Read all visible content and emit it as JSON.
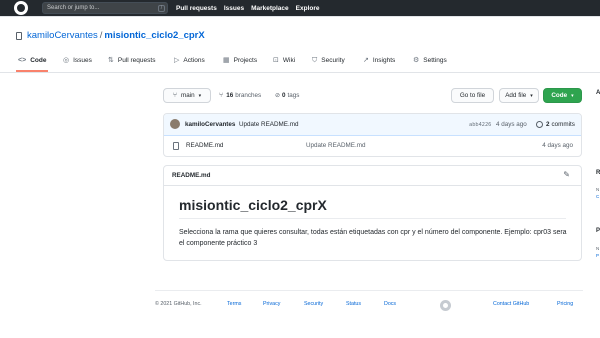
{
  "header": {
    "search_placeholder": "Search or jump to...",
    "slash_key": "/",
    "nav": [
      "Pull requests",
      "Issues",
      "Marketplace",
      "Explore"
    ]
  },
  "repo": {
    "owner": "kamiloCervantes",
    "separator": "/",
    "name": "misiontic_ciclo2_cprX"
  },
  "tabs": [
    {
      "label": "Code",
      "icon": "<>"
    },
    {
      "label": "Issues",
      "icon": "◎"
    },
    {
      "label": "Pull requests",
      "icon": "⇅"
    },
    {
      "label": "Actions",
      "icon": "▷"
    },
    {
      "label": "Projects",
      "icon": "▦"
    },
    {
      "label": "Wiki",
      "icon": "⊡"
    },
    {
      "label": "Security",
      "icon": "⛉"
    },
    {
      "label": "Insights",
      "icon": "↗"
    },
    {
      "label": "Settings",
      "icon": "⚙"
    }
  ],
  "toolbar": {
    "branch": "main",
    "branches_count": "16",
    "branches_label": "branches",
    "tags_count": "0",
    "tags_label": "tags",
    "go_to_file": "Go to file",
    "add_file": "Add file",
    "code": "Code"
  },
  "commit": {
    "author": "kamiloCervantes",
    "message": "Update README.md",
    "sha": "abb4226",
    "time": "4 days ago",
    "count": "2",
    "count_label": "commits"
  },
  "files": [
    {
      "name": "README.md",
      "message": "Update README.md",
      "time": "4 days ago"
    }
  ],
  "readme": {
    "file_label": "README.md",
    "title": "misiontic_ciclo2_cprX",
    "paragraph": "Selecciona la rama que quieres consultar, todas están etiquetadas con cpr y el número del componente. Ejemplo: cpr03 sera el componente práctico 3"
  },
  "footer": {
    "copyright": "© 2021 GitHub, Inc.",
    "links_left": [
      "Terms",
      "Privacy",
      "Security",
      "Status",
      "Docs"
    ],
    "links_right": [
      "Contact GitHub",
      "Pricing"
    ]
  },
  "colors": {
    "header_bg": "#24292e",
    "link": "#0366d6",
    "accent_underline": "#f9826c",
    "code_button": "#2ea44f"
  }
}
